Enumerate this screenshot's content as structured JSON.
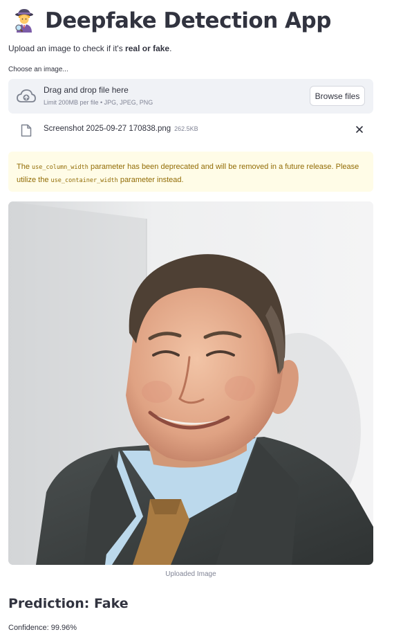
{
  "header": {
    "emoji_icon": "detective-icon",
    "title": "Deepfake Detection App"
  },
  "intro": {
    "prefix": "Upload an image to check if it's ",
    "bold": "real or fake",
    "suffix": "."
  },
  "uploader": {
    "label": "Choose an image...",
    "drag_text": "Drag and drop file here",
    "limit_text": "Limit 200MB per file • JPG, JPEG, PNG",
    "browse_label": "Browse files",
    "icon": "cloud-upload-icon"
  },
  "uploaded_file": {
    "name": "Screenshot 2025-09-27 170838.png",
    "size": "262.5KB",
    "icon": "file-icon",
    "remove_icon": "close-icon"
  },
  "warning": {
    "part1": "The ",
    "code1": "use_column_width",
    "part2": " parameter has been deprecated and will be removed in a future release. Please utilize the ",
    "code2": "use_container_width",
    "part3": " parameter instead."
  },
  "image": {
    "caption": "Uploaded Image"
  },
  "result": {
    "prediction": "Prediction: Fake",
    "confidence": "Confidence: 99.96%"
  },
  "colors": {
    "text": "#31333f",
    "muted": "#808495",
    "dropzone_bg": "#f0f2f6",
    "warning_bg": "#fffce7",
    "warning_text": "#926c05"
  }
}
